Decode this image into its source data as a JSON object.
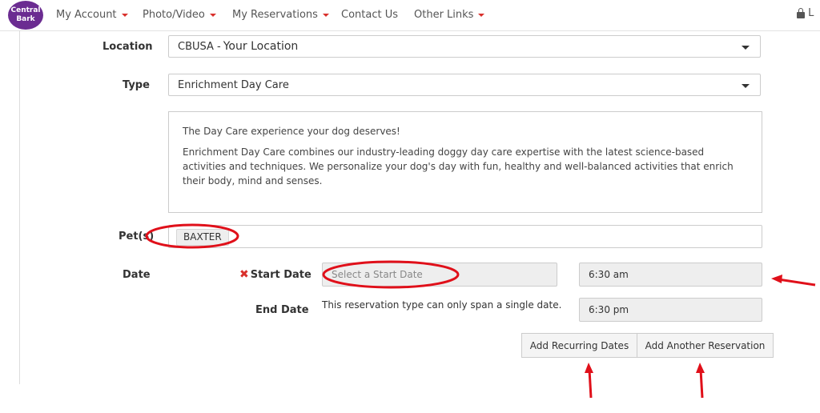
{
  "brand": {
    "logo_line1": "Central",
    "logo_line2": "Bark"
  },
  "nav": {
    "items": [
      {
        "label": "My Account",
        "dropdown": true
      },
      {
        "label": "Photo/Video",
        "dropdown": true
      },
      {
        "label": "My Reservations",
        "dropdown": true
      },
      {
        "label": "Contact Us",
        "dropdown": false
      },
      {
        "label": "Other Links",
        "dropdown": true
      }
    ],
    "login_text": "L",
    "accent_color": "#d9302c"
  },
  "form": {
    "location": {
      "label": "Location",
      "prefix": "CBUSA - ",
      "value": "Your Location"
    },
    "type": {
      "label": "Type",
      "value": "Enrichment Day Care"
    },
    "description": {
      "headline": "The Day Care experience your dog deserves!",
      "body": "Enrichment Day Care combines our industry-leading doggy day care expertise with the latest science-based activities and techniques. We personalize your dog's day with fun, healthy and well-balanced activities that enrich their body, mind and senses."
    },
    "pets": {
      "label": "Pet(s)",
      "selected": [
        "BAXTER"
      ]
    },
    "date": {
      "label": "Date",
      "start": {
        "required_icon": "✖",
        "label": "Start Date",
        "placeholder": "Select a Start Date",
        "time": "6:30 am"
      },
      "end": {
        "label": "End Date",
        "note": "This reservation type can only span a single date.",
        "time": "6:30 pm"
      }
    },
    "buttons": {
      "recurring": "Add Recurring Dates",
      "another": "Add Another Reservation"
    }
  },
  "annotation_color": "#e0101a"
}
